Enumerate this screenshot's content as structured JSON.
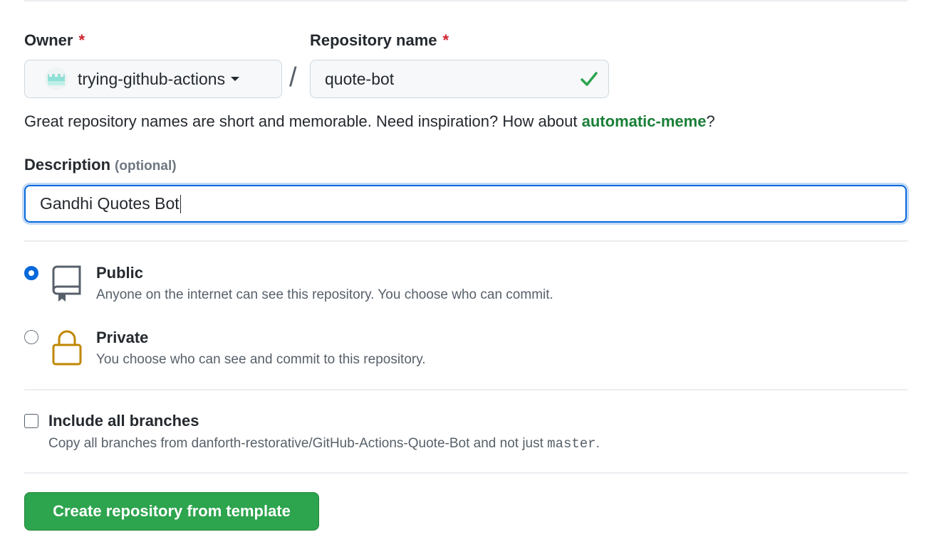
{
  "owner": {
    "label": "Owner",
    "required_mark": "*",
    "value": "trying-github-actions"
  },
  "separator": "/",
  "repo_name": {
    "label": "Repository name",
    "required_mark": "*",
    "value": "quote-bot"
  },
  "hint": {
    "text": "Great repository names are short and memorable. Need inspiration? How about ",
    "suggestion": "automatic-meme",
    "suffix": "?"
  },
  "description": {
    "label": "Description",
    "optional_label": "(optional)",
    "value": "Gandhi Quotes Bot"
  },
  "visibility": {
    "selected": "public",
    "public": {
      "title": "Public",
      "description": "Anyone on the internet can see this repository. You choose who can commit."
    },
    "private": {
      "title": "Private",
      "description": "You choose who can see and commit to this repository."
    }
  },
  "include_branches": {
    "label": "Include all branches",
    "checked": false,
    "help_prefix": "Copy all branches from danforth-restorative/GitHub-Actions-Quote-Bot and not just ",
    "branch": "master",
    "help_suffix": "."
  },
  "create_button": {
    "label": "Create repository from template"
  },
  "colors": {
    "primary_button": "#2da44e",
    "focus_blue": "#0969da",
    "success_green": "#1a7f37",
    "required_red": "#cf222e",
    "lock_gold": "#bf8700"
  },
  "icons": {
    "owner_avatar": "org-avatar-icon",
    "valid": "check-icon",
    "public": "repo-book-icon",
    "private": "lock-icon",
    "dropdown": "caret-down-icon"
  }
}
